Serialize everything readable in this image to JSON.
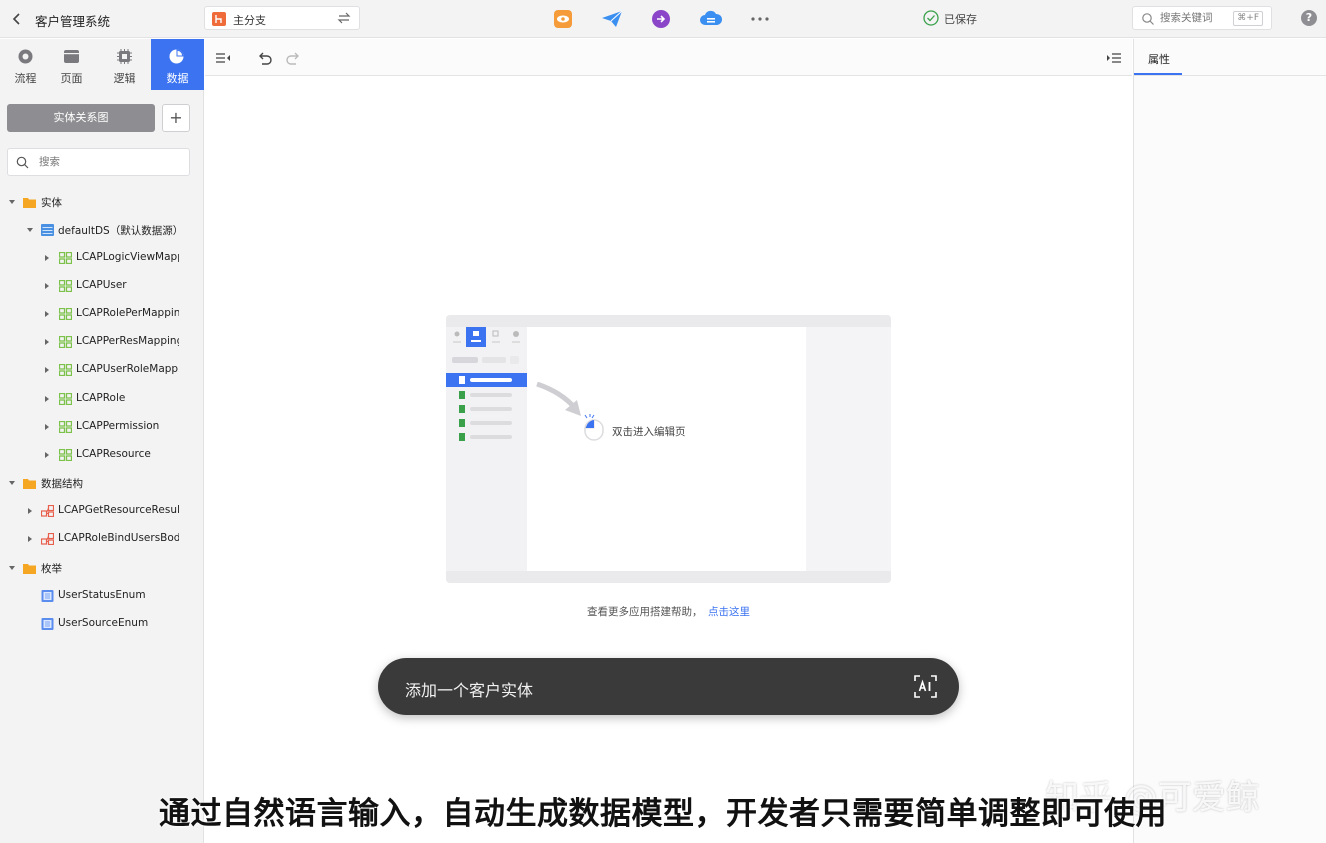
{
  "header": {
    "title": "客户管理系统",
    "branch": "主分支",
    "saved_status": "已保存",
    "search_placeholder": "搜索关键词",
    "search_shortcut": "⌘+F",
    "help": "?"
  },
  "nav_tabs": [
    {
      "label": "流程",
      "icon": "flow-icon"
    },
    {
      "label": "页面",
      "icon": "page-icon"
    },
    {
      "label": "逻辑",
      "icon": "logic-icon"
    },
    {
      "label": "数据",
      "icon": "data-icon",
      "active": true
    }
  ],
  "sidebar": {
    "er_button": "实体关系图",
    "add_button": "+",
    "search_placeholder": "搜索",
    "tree": {
      "entities": {
        "label": "实体",
        "datasource": "defaultDS（默认数据源）",
        "items": [
          "LCAPLogicViewMapping",
          "LCAPUser",
          "LCAPRolePerMapping",
          "LCAPPerResMapping",
          "LCAPUserRoleMapping",
          "LCAPRole",
          "LCAPPermission",
          "LCAPResource"
        ]
      },
      "structures": {
        "label": "数据结构",
        "items": [
          "LCAPGetResourceResult",
          "LCAPRoleBindUsersBody"
        ]
      },
      "enums": {
        "label": "枚举",
        "items": [
          "UserStatusEnum",
          "UserSourceEnum"
        ]
      }
    }
  },
  "properties": {
    "tab": "属性"
  },
  "canvas": {
    "illustration_hint": "双击进入编辑页",
    "help_text": "查看更多应用搭建帮助，",
    "help_link": "点击这里"
  },
  "ai_prompt": {
    "text": "添加一个客户实体",
    "icon": "ai-icon"
  },
  "caption": "通过自然语言输入，自动生成数据模型，开发者只需要简单调整即可使用",
  "watermark": "知乎 @可爱鲸",
  "colors": {
    "accent": "#3b73f0",
    "folder": "#f5a623",
    "entity_icon": "#7cc24a"
  }
}
